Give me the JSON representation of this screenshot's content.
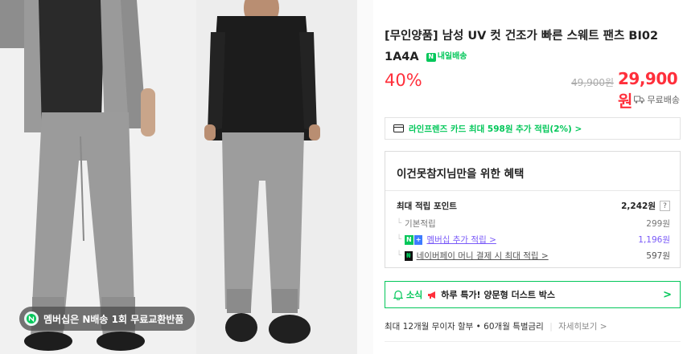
{
  "gallery": {
    "membership_badge": "멤버십은 N배송 1회 무료교환반품"
  },
  "product": {
    "title": "[무인양품] 남성 UV 컷 건조가 빠른 스웨트 팬츠 BI02 1A4A",
    "delivery_tag": "내일배송",
    "discount": "40%",
    "original_price": "49,900원",
    "sale_price": "29,900원",
    "shipping": "무료배송"
  },
  "card_benefit": {
    "text": "라인프렌즈 카드 최대 598원 추가 적립(2%) >"
  },
  "benefits": {
    "title": "이건못참지님만을 위한 혜택",
    "max_label": "최대 적립 포인트",
    "max_value": "2,242원",
    "help": "?",
    "basic_label": "기본적립",
    "basic_value": "299원",
    "member_label": "멤버십 추가 적립 >",
    "member_value": "1,196원",
    "pay_label": "네이버페이 머니 결제 시 최대 적립 >",
    "pay_value": "597원"
  },
  "news": {
    "label": "소식",
    "text": "하루 특가! 양문형 더스트 박스",
    "chevron": ">"
  },
  "installment": {
    "text": "최대 12개월 무이자 할부 • 60개월 특별금리",
    "more": "자세히보기 >"
  },
  "colors": {
    "accent_green": "#03c75a",
    "price_red": "#ff2f3b",
    "member_purple": "#7a5af8"
  }
}
